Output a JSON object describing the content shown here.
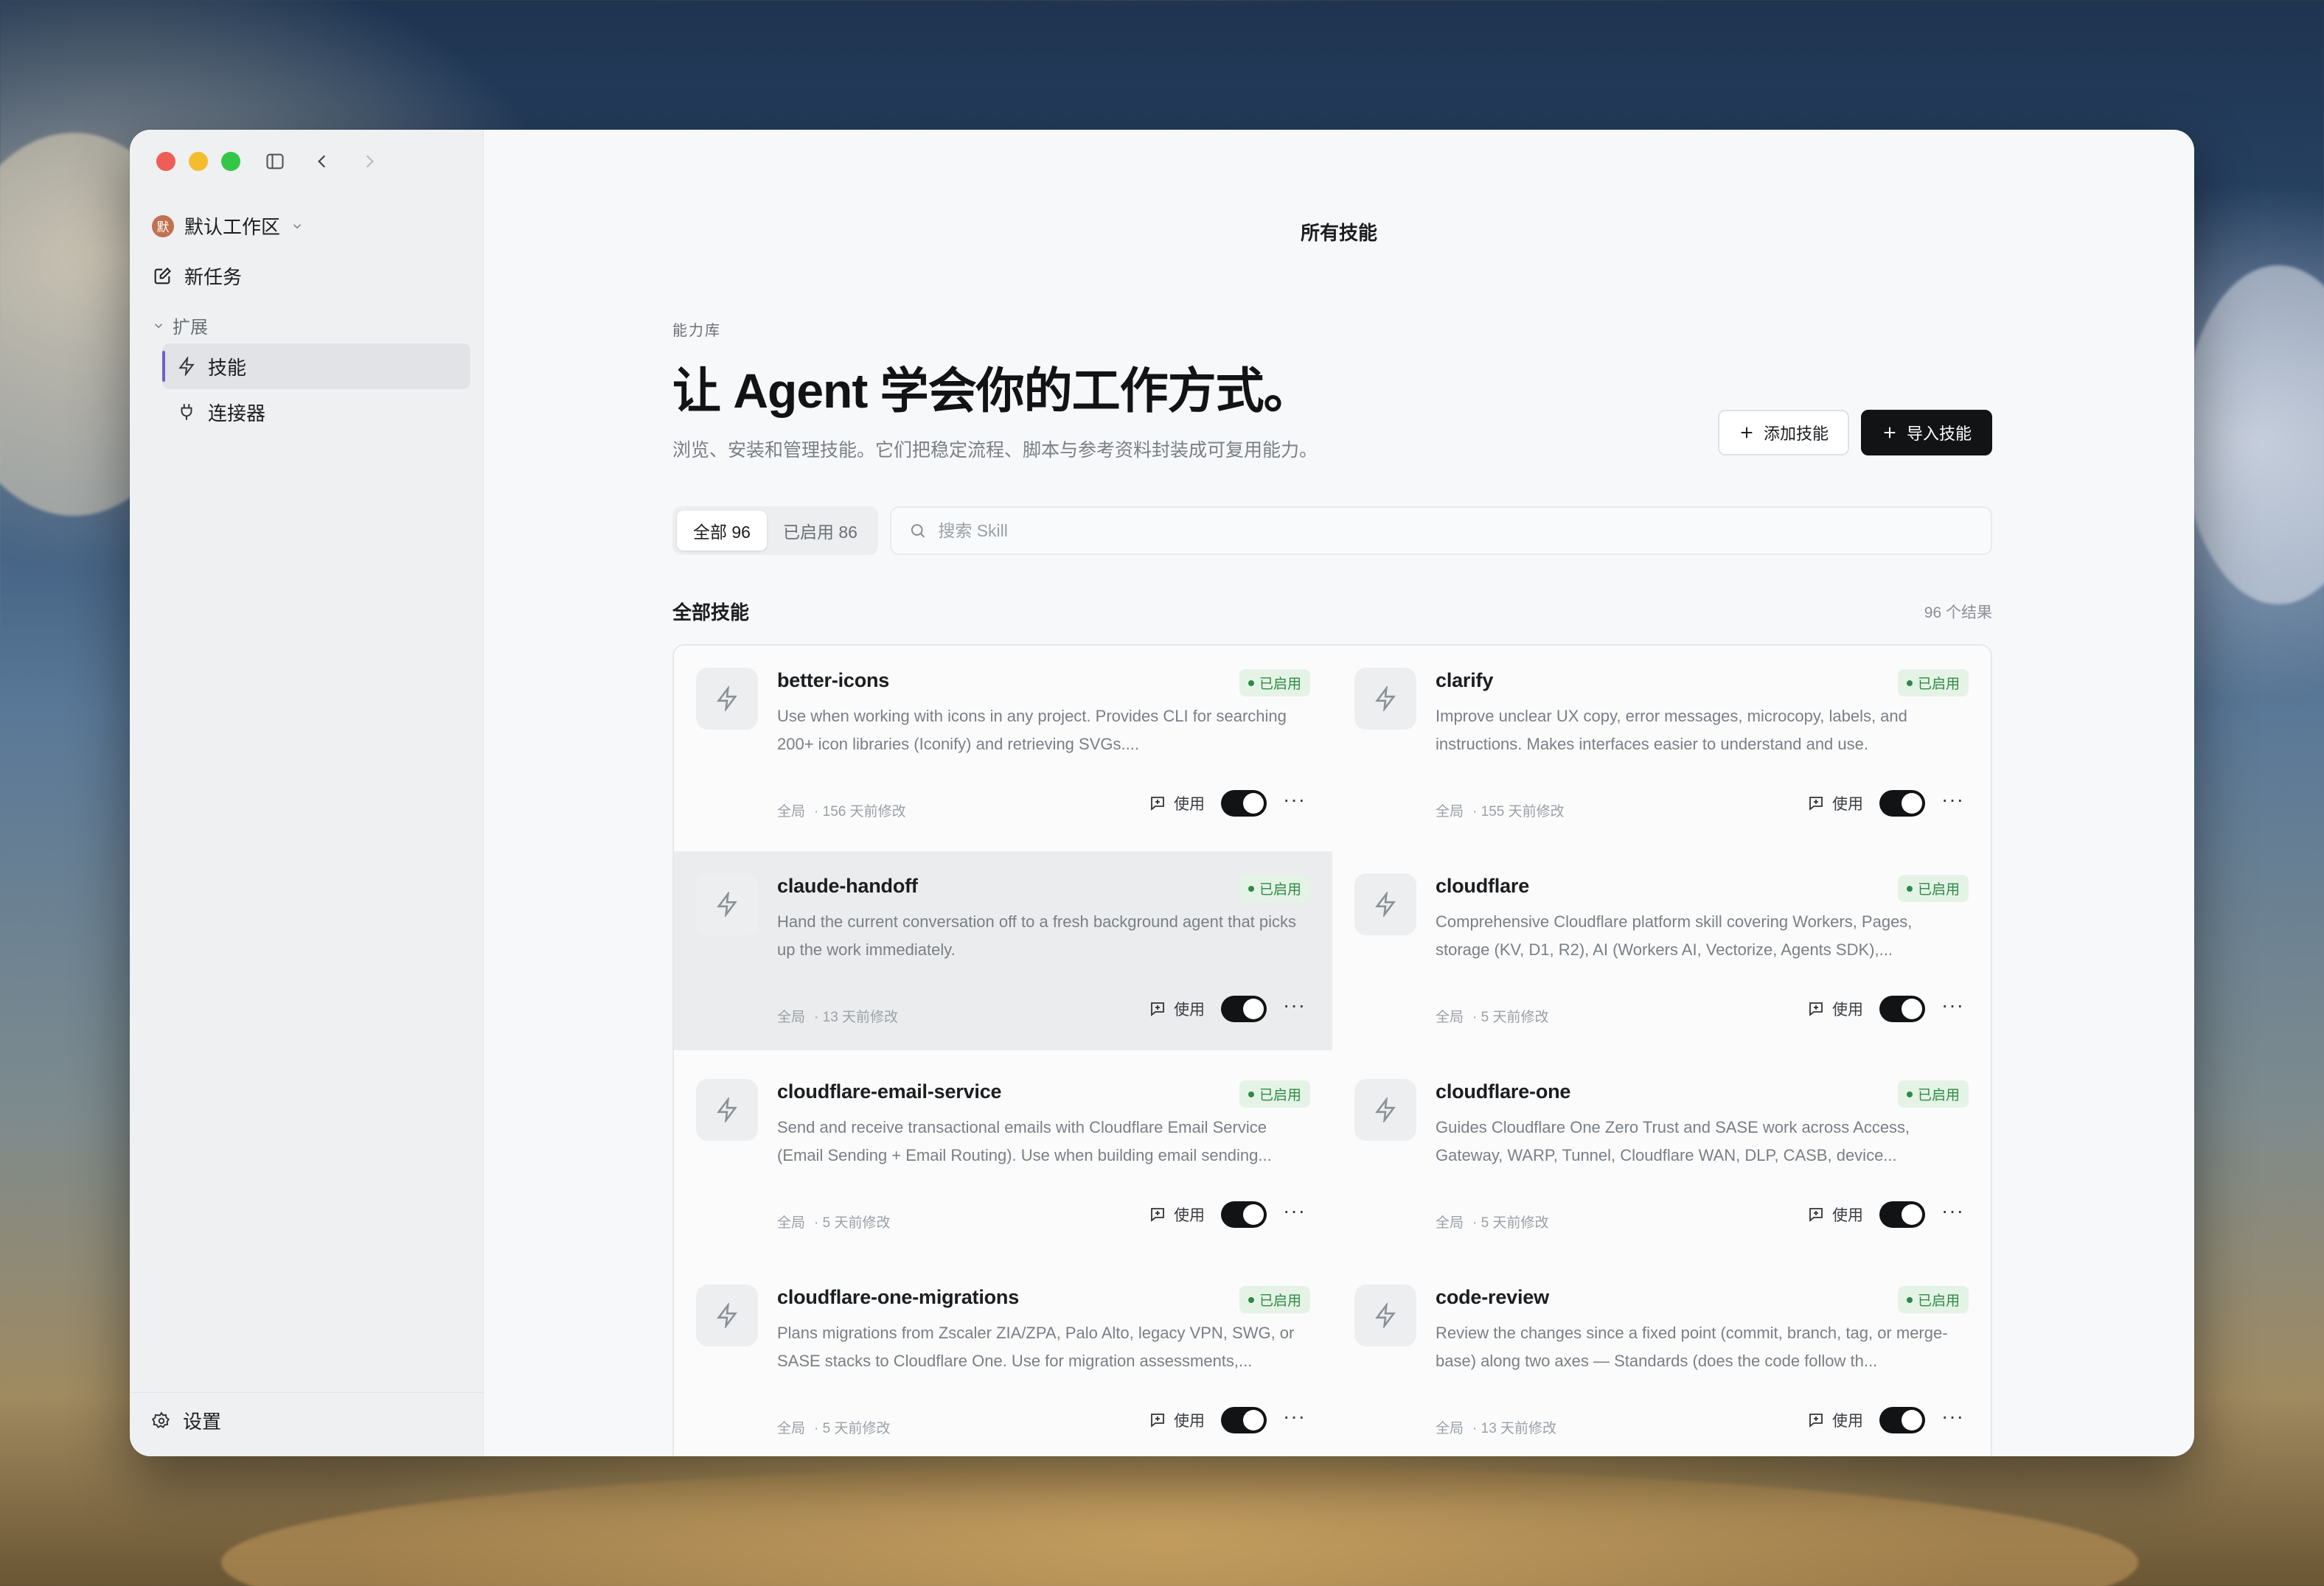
{
  "window": {
    "title": "所有技能"
  },
  "sidebar": {
    "workspace": {
      "avatar_text": "默",
      "name": "默认工作区"
    },
    "new_task": "新任务",
    "section": "扩展",
    "items": [
      {
        "label": "技能",
        "icon": "bolt-icon",
        "active": true
      },
      {
        "label": "连接器",
        "icon": "plug-icon",
        "active": false
      }
    ],
    "settings": "设置"
  },
  "page": {
    "eyebrow": "能力库",
    "hero": "让 Agent 学会你的工作方式。",
    "subtitle": "浏览、安装和管理技能。它们把稳定流程、脚本与参考资料封装成可复用能力。",
    "add_button": "添加技能",
    "import_button": "导入技能",
    "filters": {
      "all": "全部 96",
      "enabled": "已启用 86"
    },
    "search_placeholder": "搜索 Skill",
    "list_title": "全部技能",
    "result_count": "96 个结果"
  },
  "skills": [
    {
      "name": "better-icons",
      "badge": "已启用",
      "desc": "Use when working with icons in any project. Provides CLI for searching 200+ icon libraries (Iconify) and retrieving SVGs....",
      "scope": "全局",
      "modified": "· 156 天前修改",
      "use": "使用",
      "enabled": true
    },
    {
      "name": "clarify",
      "badge": "已启用",
      "desc": "Improve unclear UX copy, error messages, microcopy, labels, and instructions. Makes interfaces easier to understand and use.",
      "scope": "全局",
      "modified": "· 155 天前修改",
      "use": "使用",
      "enabled": true
    },
    {
      "name": "claude-handoff",
      "badge": "已启用",
      "desc": "Hand the current conversation off to a fresh background agent that picks up the work immediately.",
      "scope": "全局",
      "modified": "· 13 天前修改",
      "use": "使用",
      "enabled": true
    },
    {
      "name": "cloudflare",
      "badge": "已启用",
      "desc": "Comprehensive Cloudflare platform skill covering Workers, Pages, storage (KV, D1, R2), AI (Workers AI, Vectorize, Agents SDK),...",
      "scope": "全局",
      "modified": "· 5 天前修改",
      "use": "使用",
      "enabled": true
    },
    {
      "name": "cloudflare-email-service",
      "badge": "已启用",
      "desc": "Send and receive transactional emails with Cloudflare Email Service (Email Sending + Email Routing). Use when building email sending...",
      "scope": "全局",
      "modified": "· 5 天前修改",
      "use": "使用",
      "enabled": true
    },
    {
      "name": "cloudflare-one",
      "badge": "已启用",
      "desc": "Guides Cloudflare One Zero Trust and SASE work across Access, Gateway, WARP, Tunnel, Cloudflare WAN, DLP, CASB, device...",
      "scope": "全局",
      "modified": "· 5 天前修改",
      "use": "使用",
      "enabled": true
    },
    {
      "name": "cloudflare-one-migrations",
      "badge": "已启用",
      "desc": "Plans migrations from Zscaler ZIA/ZPA, Palo Alto, legacy VPN, SWG, or SASE stacks to Cloudflare One. Use for migration assessments,...",
      "scope": "全局",
      "modified": "· 5 天前修改",
      "use": "使用",
      "enabled": true
    },
    {
      "name": "code-review",
      "badge": "已启用",
      "desc": "Review the changes since a fixed point (commit, branch, tag, or merge-base) along two axes — Standards (does the code follow th...",
      "scope": "全局",
      "modified": "· 13 天前修改",
      "use": "使用",
      "enabled": true
    }
  ],
  "colors": {
    "accent": "#6f5fd0",
    "badge_green": "#2f8a44",
    "toggle_on": "#111315"
  }
}
